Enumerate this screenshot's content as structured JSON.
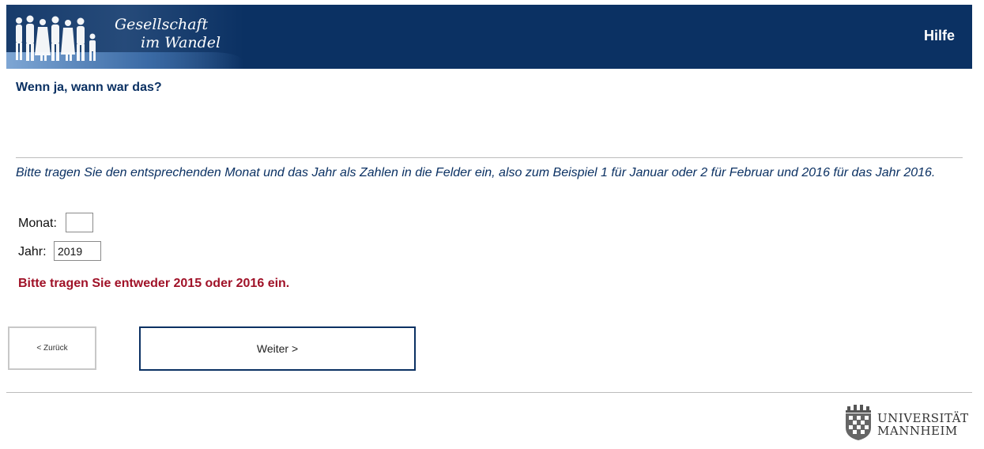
{
  "header": {
    "logo_line1": "Gesellschaft",
    "logo_line2": "im Wandel",
    "logo_icon": "family-silhouettes-icon",
    "help_label": "Hilfe",
    "background_color": "#0b3163"
  },
  "question": {
    "title": "Wenn ja, wann war das?",
    "instruction": "Bitte tragen Sie den entsprechenden Monat und das Jahr als Zahlen in die Felder ein, also zum Beispiel 1 für Januar oder 2 für Februar und 2016 für das Jahr 2016."
  },
  "form": {
    "month_label": "Monat:",
    "month_value": "",
    "year_label": "Jahr:",
    "year_value": "2019"
  },
  "error": {
    "message": "Bitte tragen Sie entweder 2015 oder 2016 ein.",
    "color": "#a01228"
  },
  "navigation": {
    "back_label": "< Zurück",
    "next_label": "Weiter >"
  },
  "footer": {
    "university_line1": "UNIVERSITÄT",
    "university_line2": "MANNHEIM",
    "university_icon": "university-crest-icon"
  }
}
